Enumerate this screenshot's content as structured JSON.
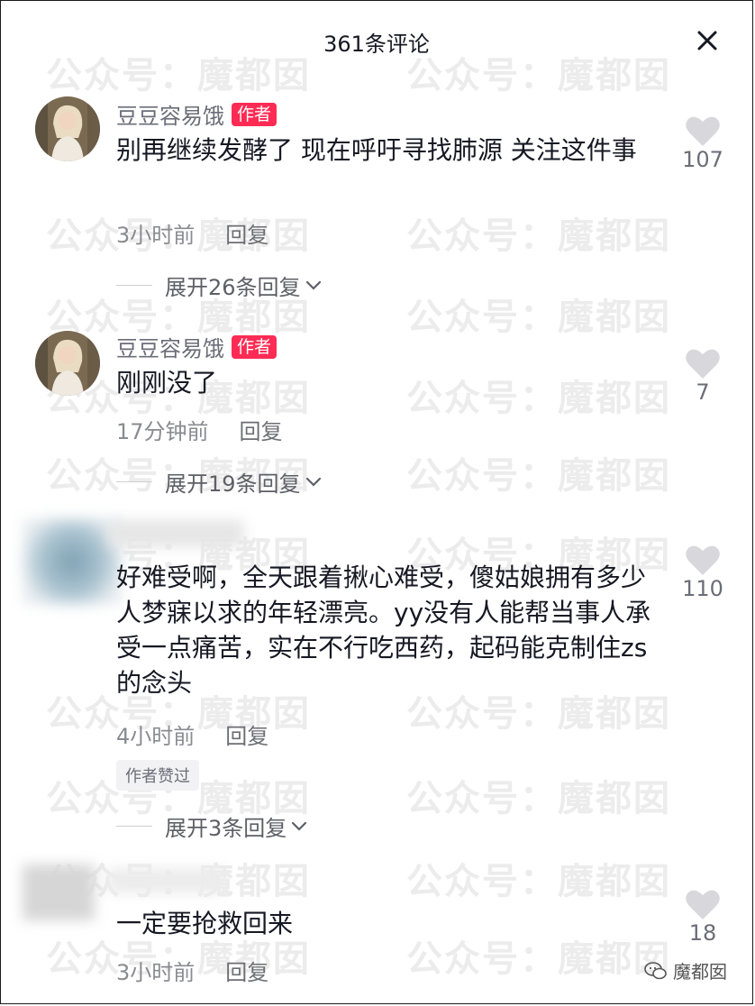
{
  "header": {
    "title": "361条评论"
  },
  "watermark": {
    "text": "公众号：魔都囡"
  },
  "comments": [
    {
      "username": "豆豆容易饿",
      "author_tag": "作者",
      "text": "别再继续发酵了 现在呼吁寻找肺源 关注这件事",
      "time": "3小时前",
      "reply": "回复",
      "likes": "107",
      "expand": "展开26条回复"
    },
    {
      "username": "豆豆容易饿",
      "author_tag": "作者",
      "text": "刚刚没了",
      "time": "17分钟前",
      "reply": "回复",
      "likes": "7",
      "expand": "展开19条回复"
    },
    {
      "text": "好难受啊，全天跟着揪心难受，傻姑娘拥有多少人梦寐以求的年轻漂亮。yy没有人能帮当事人承受一点痛苦，实在不行吃西药，起码能克制住zs的念头",
      "time": "4小时前",
      "reply": "回复",
      "likes": "110",
      "liked_by_author": "作者赞过",
      "expand": "展开3条回复"
    },
    {
      "text": "一定要抢救回来",
      "time": "3小时前",
      "reply": "回复",
      "likes": "18"
    }
  ],
  "footer": {
    "logo_text": "魔都囡"
  },
  "colors": {
    "author_tag": "#fe2c55",
    "text": "#161823",
    "muted": "#8a8b91"
  }
}
